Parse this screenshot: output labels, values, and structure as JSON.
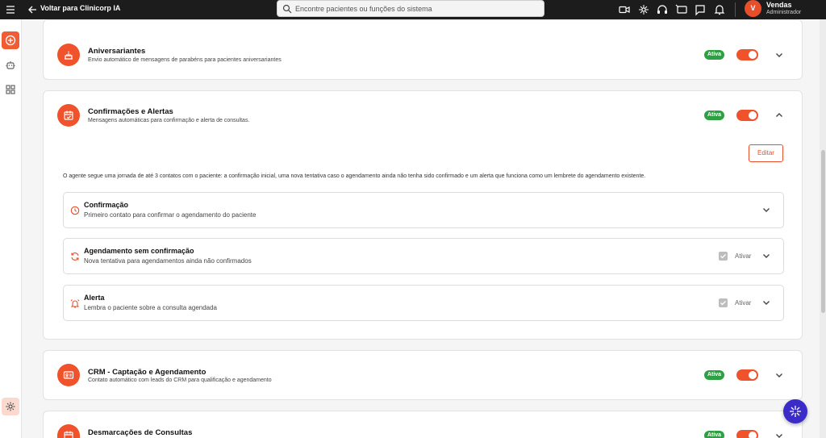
{
  "topbar": {
    "back_label": "Voltar para Clinicorp IA",
    "search_placeholder": "Encontre pacientes ou funções do sistema",
    "user_initial": "V",
    "user_name": "Vendas",
    "user_role": "Administrador"
  },
  "cards": [
    {
      "title": "Aniversariantes",
      "description": "Envio automático de mensagens de parabéns para pacientes aniversariantes",
      "badge": "Ativa",
      "icon": "cake-icon"
    },
    {
      "title": "Confirmações e Alertas",
      "description": "Mensagens automáticas para confirmação e alerta de consultas.",
      "badge": "Ativa",
      "icon": "calendar-check-icon",
      "edit_label": "Editar",
      "intro": "O agente segue uma jornada de até 3 contatos com o paciente: a confirmação inicial, uma nova tentativa caso o agendamento ainda não tenha sido confirmado e um alerta que funciona como um lembrete do agendamento existente.",
      "steps": [
        {
          "title": "Confirmação",
          "description": "Primeiro contato para confirmar o agendamento do paciente",
          "icon": "clock-icon"
        },
        {
          "title": "Agendamento sem confirmação",
          "description": "Nova tentativa para agendamentos ainda não confirmados",
          "icon": "refresh-icon",
          "checkbox_label": "Ativar"
        },
        {
          "title": "Alerta",
          "description": "Lembra o paciente sobre a consulta agendada",
          "icon": "alarm-icon",
          "checkbox_label": "Ativar"
        }
      ]
    },
    {
      "title": "CRM - Captação e Agendamento",
      "description": "Contato automático com leads do CRM para qualificação e agendamento",
      "badge": "Ativa",
      "icon": "id-card-icon"
    },
    {
      "title": "Desmarcações de Consultas",
      "description": "",
      "badge": "Ativa",
      "icon": "calendar-x-icon"
    }
  ],
  "colors": {
    "accent": "#f0522c",
    "active_badge": "#2ea043",
    "fab": "#3b2bc9",
    "topbar": "#1c1c1c"
  }
}
